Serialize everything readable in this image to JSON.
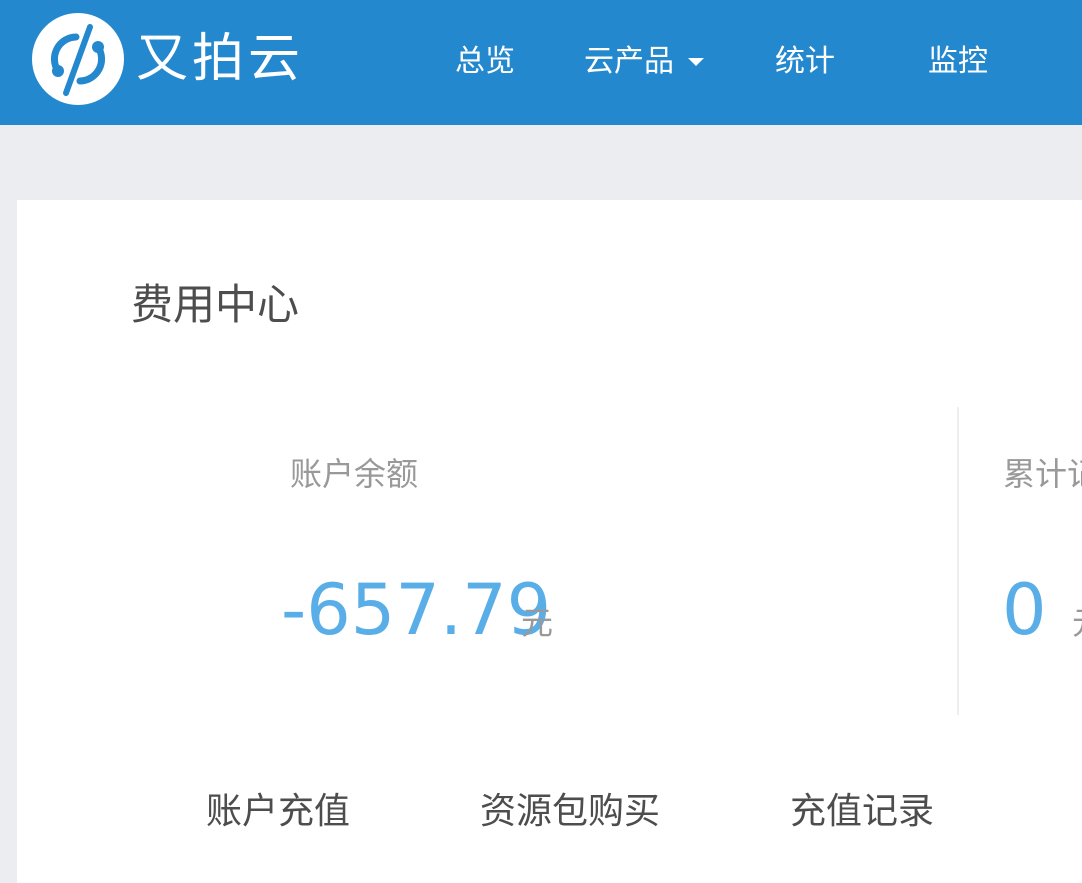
{
  "brand": {
    "logo_icon": "upyun-logo-icon",
    "name": "又拍云"
  },
  "nav": {
    "items": [
      {
        "label": "总览"
      },
      {
        "label": "云产品"
      },
      {
        "label": "统计"
      },
      {
        "label": "监控"
      }
    ],
    "dropdown_icon": "caret-down-icon"
  },
  "page": {
    "title": "费用中心"
  },
  "balance": {
    "label": "账户余额",
    "value": "-657.79",
    "unit": "元"
  },
  "cumulative": {
    "label": "累计记",
    "value": "0",
    "unit": "元"
  },
  "actions": [
    {
      "label": "账户充值"
    },
    {
      "label": "资源包购买"
    },
    {
      "label": "充值记录"
    }
  ],
  "colors": {
    "header_bg": "#2488cf",
    "page_bg": "#ebedf0",
    "value_blue": "#5aaee8",
    "label_gray": "#999999",
    "text_dark": "#4d4d4d"
  }
}
